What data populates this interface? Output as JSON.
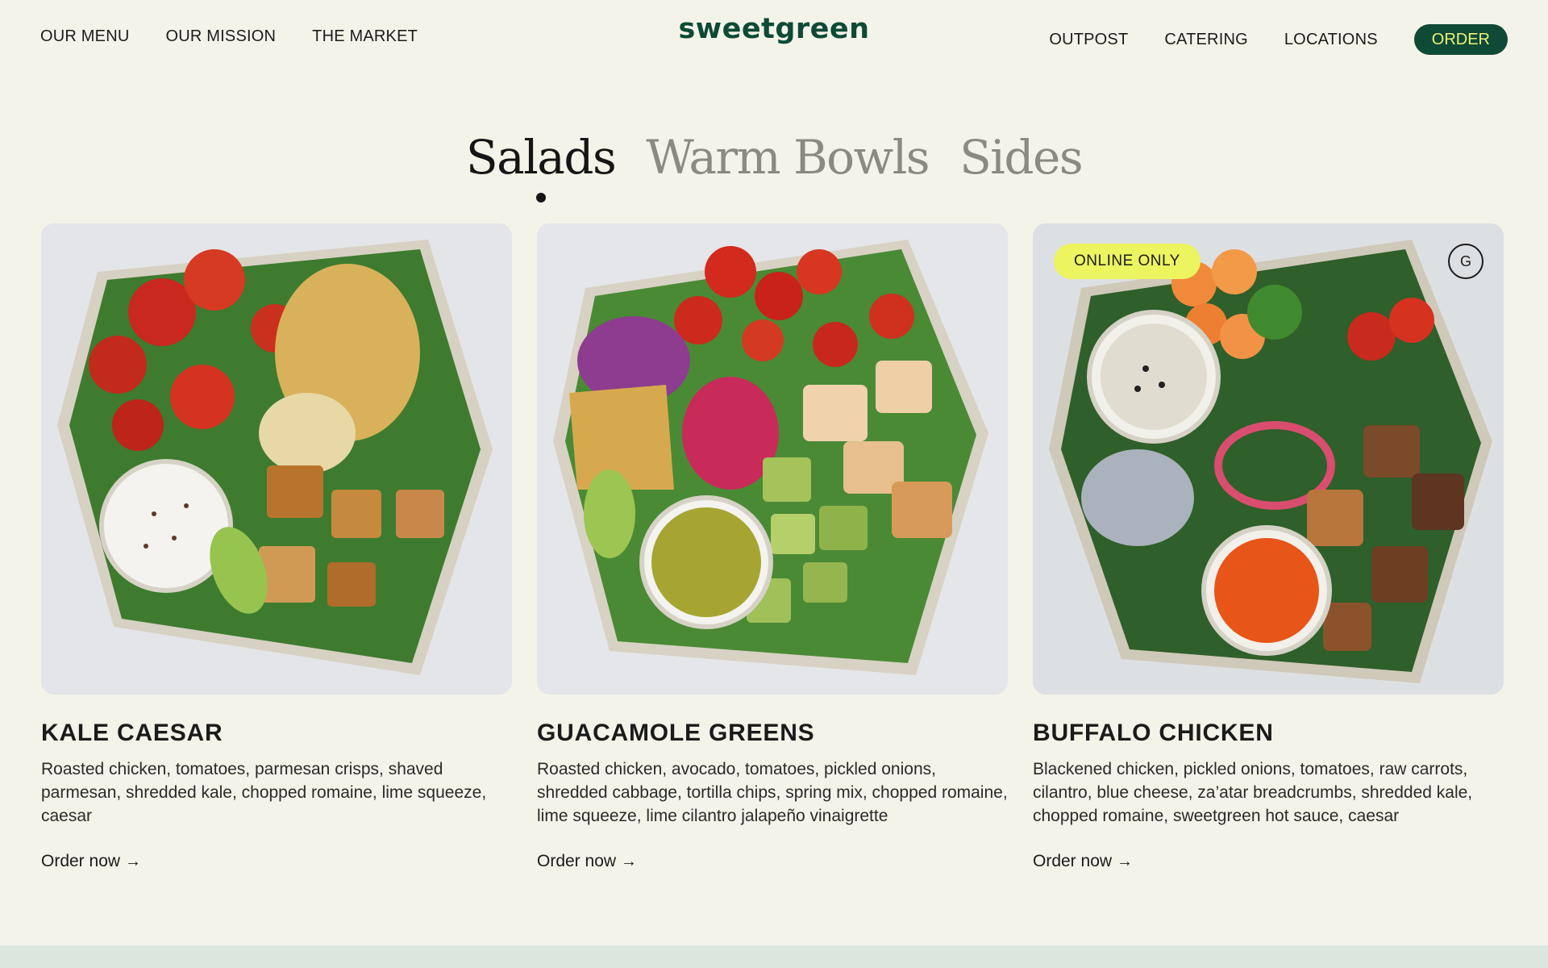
{
  "header": {
    "nav_left": [
      "OUR MENU",
      "OUR MISSION",
      "THE MARKET"
    ],
    "logo": "sweetgreen",
    "nav_right": [
      "OUTPOST",
      "CATERING",
      "LOCATIONS"
    ],
    "order_label": "ORDER"
  },
  "tabs": [
    {
      "label": "Salads",
      "active": true
    },
    {
      "label": "Warm Bowls",
      "active": false
    },
    {
      "label": "Sides",
      "active": false
    }
  ],
  "cards": [
    {
      "title": "KALE CAESAR",
      "description": "Roasted chicken, tomatoes, parmesan crisps, shaved parmesan, shredded kale, chopped romaine, lime squeeze, caesar",
      "link": "Order now",
      "badge": "",
      "tag": ""
    },
    {
      "title": "GUACAMOLE GREENS",
      "description": "Roasted chicken, avocado, tomatoes, pickled onions, shredded cabbage, tortilla chips, spring mix, chopped romaine, lime squeeze, lime cilantro jalapeño vinaigrette",
      "link": "Order now",
      "badge": "",
      "tag": ""
    },
    {
      "title": "BUFFALO CHICKEN",
      "description": "Blackened chicken, pickled onions, tomatoes, raw carrots, cilantro, blue cheese, za’atar breadcrumbs, shredded kale, chopped romaine, sweetgreen hot sauce, caesar",
      "link": "Order now",
      "badge": "ONLINE ONLY",
      "tag": "G"
    }
  ],
  "colors": {
    "background": "#f4f3ea",
    "brand_green": "#0e4a35",
    "order_text": "#eef27a",
    "badge_yellow": "#ecf45f",
    "tab_inactive": "#8a8a80"
  },
  "icons": {
    "link_arrow": "arrow-right-icon"
  }
}
